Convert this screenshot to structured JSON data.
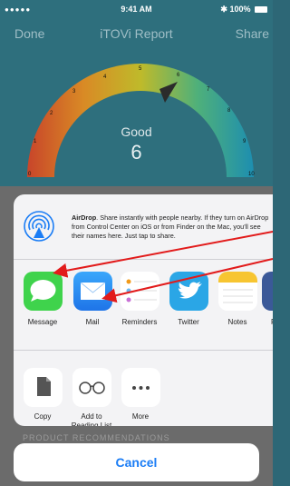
{
  "status_bar": {
    "signal": "●●●●● ",
    "time": "9:41 AM",
    "battery": "100%"
  },
  "nav": {
    "left": "Done",
    "title": "iTOVi Report",
    "right": "Share"
  },
  "gauge": {
    "label": "Good",
    "value": "6",
    "ticks": [
      "0",
      "1",
      "2",
      "3",
      "4",
      "5",
      "6",
      "7",
      "8",
      "9",
      "10"
    ]
  },
  "airdrop": {
    "title": "AirDrop",
    "description": ". Share instantly with people nearby. If they turn on AirDrop from Control Center on iOS or from Finder on the Mac, you'll see their names here. Just tap to share."
  },
  "apps": [
    {
      "label": "Message",
      "icon": "message-icon",
      "color": "#3fd34c"
    },
    {
      "label": "Mail",
      "icon": "mail-icon",
      "color": "#2e8ff4"
    },
    {
      "label": "Reminders",
      "icon": "reminders-icon",
      "color": "#ffffff"
    },
    {
      "label": "Twitter",
      "icon": "twitter-icon",
      "color": "#2aa6e6"
    },
    {
      "label": "Notes",
      "icon": "notes-icon",
      "color": "#ffffff"
    },
    {
      "label": "F",
      "icon": "facebook-icon",
      "color": "#3b5998"
    }
  ],
  "actions": [
    {
      "label": "Copy",
      "icon": "copy-icon"
    },
    {
      "label": "Add to\nReading List",
      "icon": "reading-list-icon"
    },
    {
      "label": "More",
      "icon": "more-icon"
    }
  ],
  "behind_text": "PRODUCT RECOMMENDATIONS",
  "cancel_label": "Cancel",
  "colors": {
    "annotation_arrow": "#e21b1b",
    "ios_blue": "#1b7df5"
  }
}
